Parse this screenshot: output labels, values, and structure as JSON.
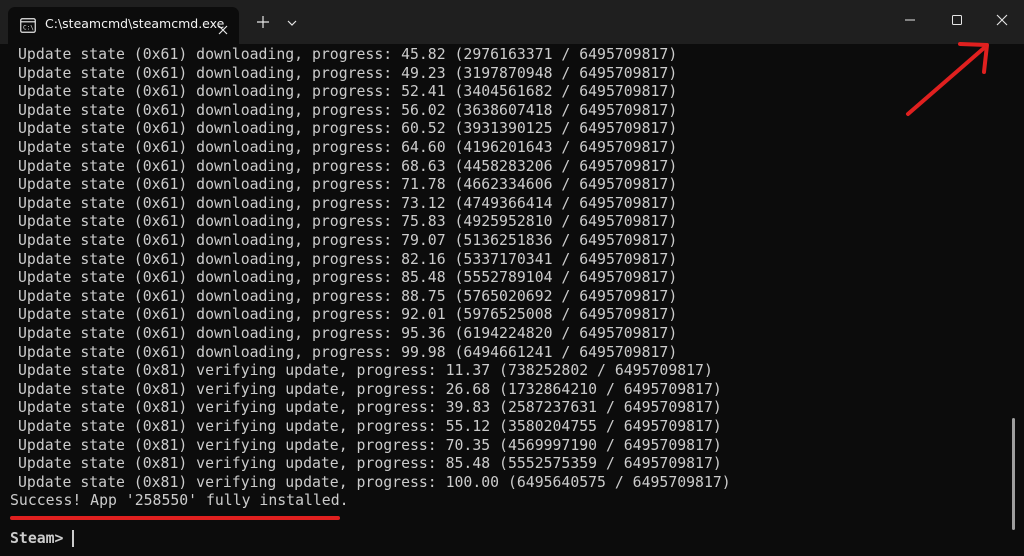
{
  "window": {
    "tab_title": "C:\\steamcmd\\steamcmd.exe",
    "icons": {
      "tab": "terminal-icon",
      "close_tab": "close-icon",
      "new_tab": "plus-icon",
      "dropdown": "chevron-down-icon",
      "minimize": "minimize-icon",
      "maximize": "maximize-icon",
      "close_window": "close-icon"
    }
  },
  "terminal": {
    "lines": [
      "Update state (0x61) downloading, progress: 45.82 (2976163371 / 6495709817)",
      "Update state (0x61) downloading, progress: 49.23 (3197870948 / 6495709817)",
      "Update state (0x61) downloading, progress: 52.41 (3404561682 / 6495709817)",
      "Update state (0x61) downloading, progress: 56.02 (3638607418 / 6495709817)",
      "Update state (0x61) downloading, progress: 60.52 (3931390125 / 6495709817)",
      "Update state (0x61) downloading, progress: 64.60 (4196201643 / 6495709817)",
      "Update state (0x61) downloading, progress: 68.63 (4458283206 / 6495709817)",
      "Update state (0x61) downloading, progress: 71.78 (4662334606 / 6495709817)",
      "Update state (0x61) downloading, progress: 73.12 (4749366414 / 6495709817)",
      "Update state (0x61) downloading, progress: 75.83 (4925952810 / 6495709817)",
      "Update state (0x61) downloading, progress: 79.07 (5136251836 / 6495709817)",
      "Update state (0x61) downloading, progress: 82.16 (5337170341 / 6495709817)",
      "Update state (0x61) downloading, progress: 85.48 (5552789104 / 6495709817)",
      "Update state (0x61) downloading, progress: 88.75 (5765020692 / 6495709817)",
      "Update state (0x61) downloading, progress: 92.01 (5976525008 / 6495709817)",
      "Update state (0x61) downloading, progress: 95.36 (6194224820 / 6495709817)",
      "Update state (0x61) downloading, progress: 99.98 (6494661241 / 6495709817)",
      "Update state (0x81) verifying update, progress: 11.37 (738252802 / 6495709817)",
      "Update state (0x81) verifying update, progress: 26.68 (1732864210 / 6495709817)",
      "Update state (0x81) verifying update, progress: 39.83 (2587237631 / 6495709817)",
      "Update state (0x81) verifying update, progress: 55.12 (3580204755 / 6495709817)",
      "Update state (0x81) verifying update, progress: 70.35 (4569997190 / 6495709817)",
      "Update state (0x81) verifying update, progress: 85.48 (5552575359 / 6495709817)",
      "Update state (0x81) verifying update, progress: 100.00 (6495640575 / 6495709817)"
    ],
    "success": "Success! App '258550' fully installed.",
    "prompt": "Steam>"
  },
  "annotations": {
    "accent_color": "#e0201f",
    "arrow": "arrow-pointing-to-close-button",
    "underline": "underline-under-success-message"
  },
  "colors": {
    "background": "#0c0c0c",
    "titlebar": "#1f1f1f",
    "text": "#cccccc"
  }
}
